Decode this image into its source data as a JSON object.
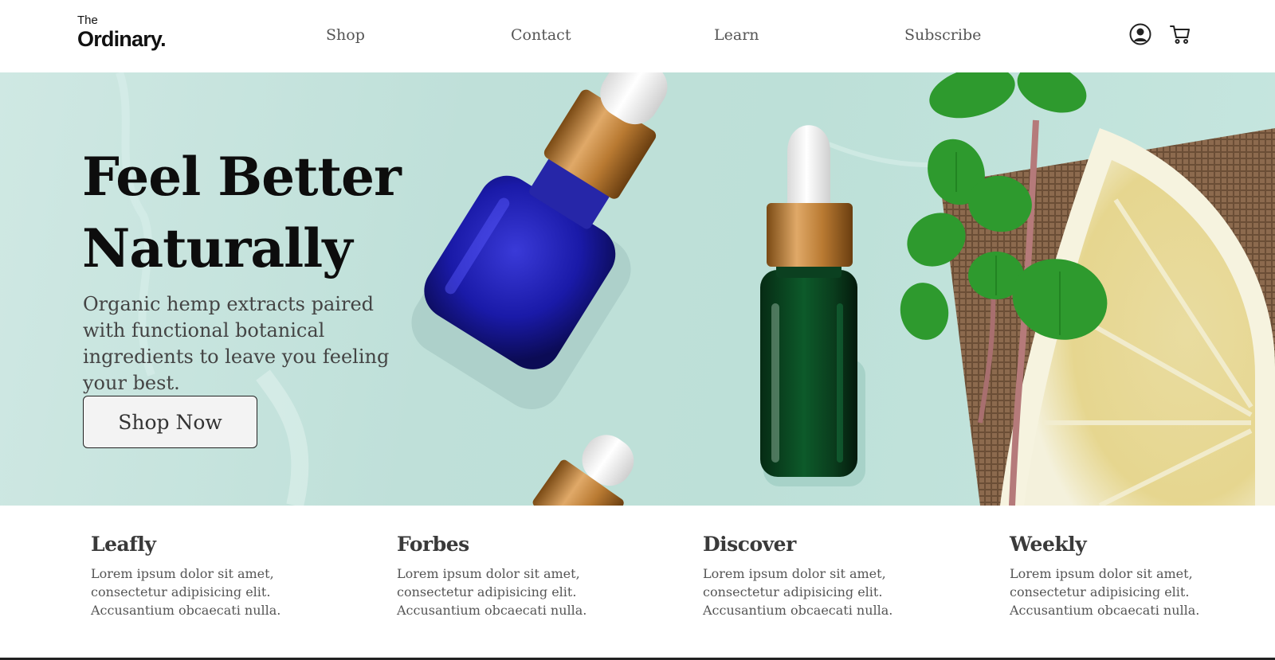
{
  "brand": {
    "the": "The",
    "name": "Ordinary."
  },
  "nav": {
    "items": [
      {
        "label": "Shop"
      },
      {
        "label": "Contact"
      },
      {
        "label": "Learn"
      },
      {
        "label": "Subscribe"
      }
    ],
    "icons": [
      "user-icon",
      "cart-icon"
    ]
  },
  "hero": {
    "title_line1": "Feel Better",
    "title_line2": "Naturally",
    "subtitle": "Organic hemp extracts paired with functional botanical ingredients to leave you feeling your best.",
    "cta_label": "Shop Now"
  },
  "features": [
    {
      "title": "Leafly",
      "text": "Lorem ipsum dolor sit amet, consectetur adipisicing elit. Accusantium obcaecati nulla."
    },
    {
      "title": "Forbes",
      "text": "Lorem ipsum dolor sit amet, consectetur adipisicing elit. Accusantium obcaecati nulla."
    },
    {
      "title": "Discover",
      "text": "Lorem ipsum dolor sit amet, consectetur adipisicing elit. Accusantium obcaecati nulla."
    },
    {
      "title": "Weekly",
      "text": "Lorem ipsum dolor sit amet, consectetur adipisicing elit. Accusantium obcaecati nulla."
    }
  ],
  "colors": {
    "hero_background": "#bfe0d9",
    "text_dark": "#0d0d0d",
    "text_muted": "#555555",
    "button_background": "#f3f3f3"
  }
}
